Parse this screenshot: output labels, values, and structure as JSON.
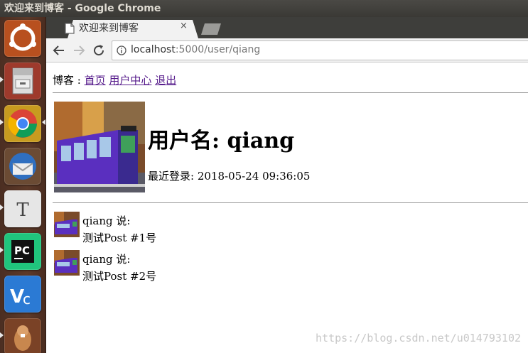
{
  "window": {
    "title": "欢迎来到博客 - Google Chrome"
  },
  "launcher": {
    "items": [
      {
        "icon": "ubuntu-dash-icon",
        "color": "#c55a24"
      },
      {
        "icon": "file-cabinet-icon",
        "color": "#a83a2e"
      },
      {
        "icon": "chrome-icon",
        "color": "#c9a227"
      },
      {
        "icon": "thunderbird-icon",
        "color": "#3c6fb0"
      },
      {
        "icon": "text-editor-icon",
        "color": "#e9e9e9"
      },
      {
        "icon": "pycharm-icon",
        "color": "#21d789"
      },
      {
        "icon": "vnc-icon",
        "color": "#2f7fd8"
      },
      {
        "icon": "beaver-icon",
        "color": "#8a4a2a"
      }
    ]
  },
  "browser": {
    "tab_title": "欢迎来到博客",
    "tab_close": "×",
    "url_host": "localhost",
    "url_rest": ":5000/user/qiang"
  },
  "page": {
    "nav": {
      "prefix": "博客 :",
      "home": "首页",
      "user_center": "用户中心",
      "logout": "退出"
    },
    "user": {
      "heading": "用户名: qiang",
      "last_seen": "最近登录: 2018-05-24 09:36:05"
    },
    "posts": [
      {
        "author_line": "qiang 说:",
        "body": "测试Post #1号"
      },
      {
        "author_line": "qiang 说:",
        "body": "测试Post #2号"
      }
    ],
    "watermark": "https://blog.csdn.net/u014793102"
  }
}
